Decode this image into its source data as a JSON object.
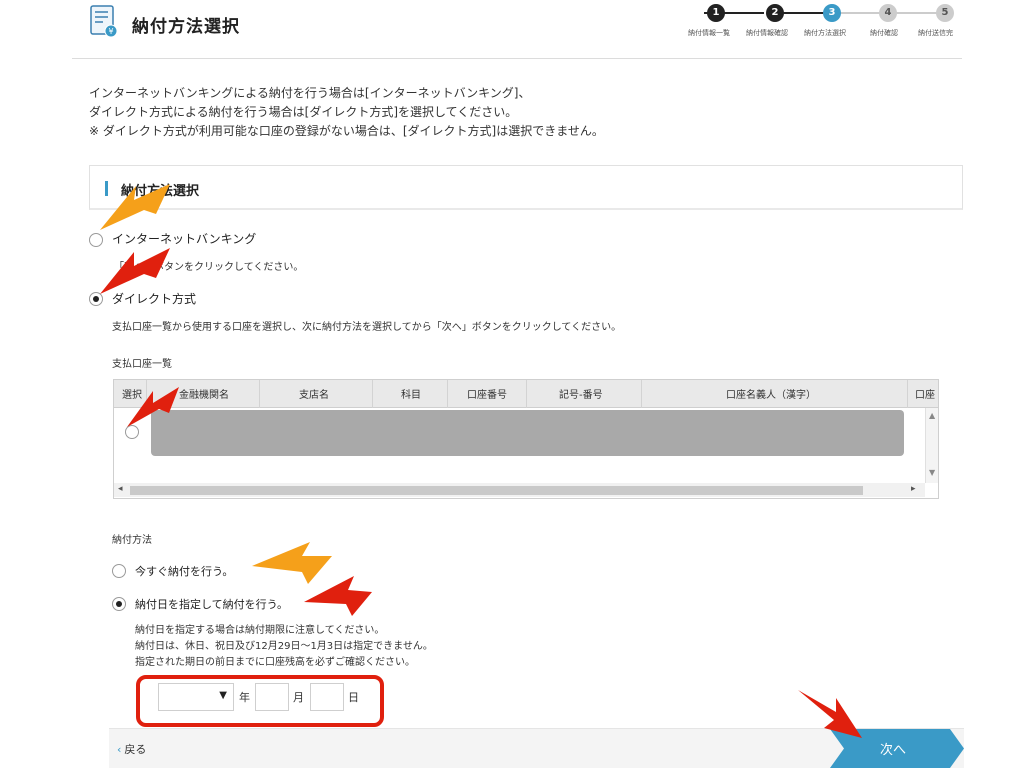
{
  "header": {
    "title": "納付方法選択",
    "steps": [
      {
        "number": "1",
        "label": "納付情報一覧",
        "state": "done"
      },
      {
        "number": "2",
        "label": "納付情報確認",
        "state": "done"
      },
      {
        "number": "3",
        "label": "納付方法選択",
        "state": "current"
      },
      {
        "number": "4",
        "label": "納付確認",
        "state": "pending"
      },
      {
        "number": "5",
        "label": "納付送信完",
        "state": "pending"
      }
    ]
  },
  "intro": {
    "line1": "インターネットバンキングによる納付を行う場合は[インターネットバンキング]、",
    "line2": "ダイレクト方式による納付を行う場合は[ダイレクト方式]を選択してください。",
    "line3": "※ ダイレクト方式が利用可能な口座の登録がない場合は、[ダイレクト方式]は選択できません。"
  },
  "section": {
    "title": "納付方法選択"
  },
  "methods": {
    "internet_banking": {
      "label": "インターネットバンキング",
      "note": "「次へ」ボタンをクリックしてください。",
      "selected": false
    },
    "direct": {
      "label": "ダイレクト方式",
      "note": "支払口座一覧から使用する口座を選択し、次に納付方法を選択してから「次へ」ボタンをクリックしてください。",
      "selected": true
    }
  },
  "accounts": {
    "title": "支払口座一覧",
    "columns": [
      "選択",
      "金融機関名",
      "支店名",
      "科目",
      "口座番号",
      "記号-番号",
      "口座名義人（漢字）",
      "口座"
    ]
  },
  "payment_timing": {
    "title": "納付方法",
    "now": {
      "label": "今すぐ納付を行う。",
      "selected": false
    },
    "scheduled": {
      "label": "納付日を指定して納付を行う。",
      "selected": true,
      "note1": "納付日を指定する場合は納付期限に注意してください。",
      "note2": "納付日は、休日、祝日及び12月29日～1月3日は指定できません。",
      "note3": "指定された期日の前日までに口座残高を必ずご確認ください。"
    },
    "date": {
      "year_unit": "年",
      "month_unit": "月",
      "day_unit": "日"
    }
  },
  "footer": {
    "back_label": "戻る",
    "next_label": "次へ"
  },
  "colors": {
    "accent": "#3a9ac7",
    "step_done": "#222222",
    "step_current": "#3a9ac7",
    "step_pending": "#cccccc",
    "annotation_orange": "#f5a01a",
    "annotation_red": "#e0200e"
  }
}
